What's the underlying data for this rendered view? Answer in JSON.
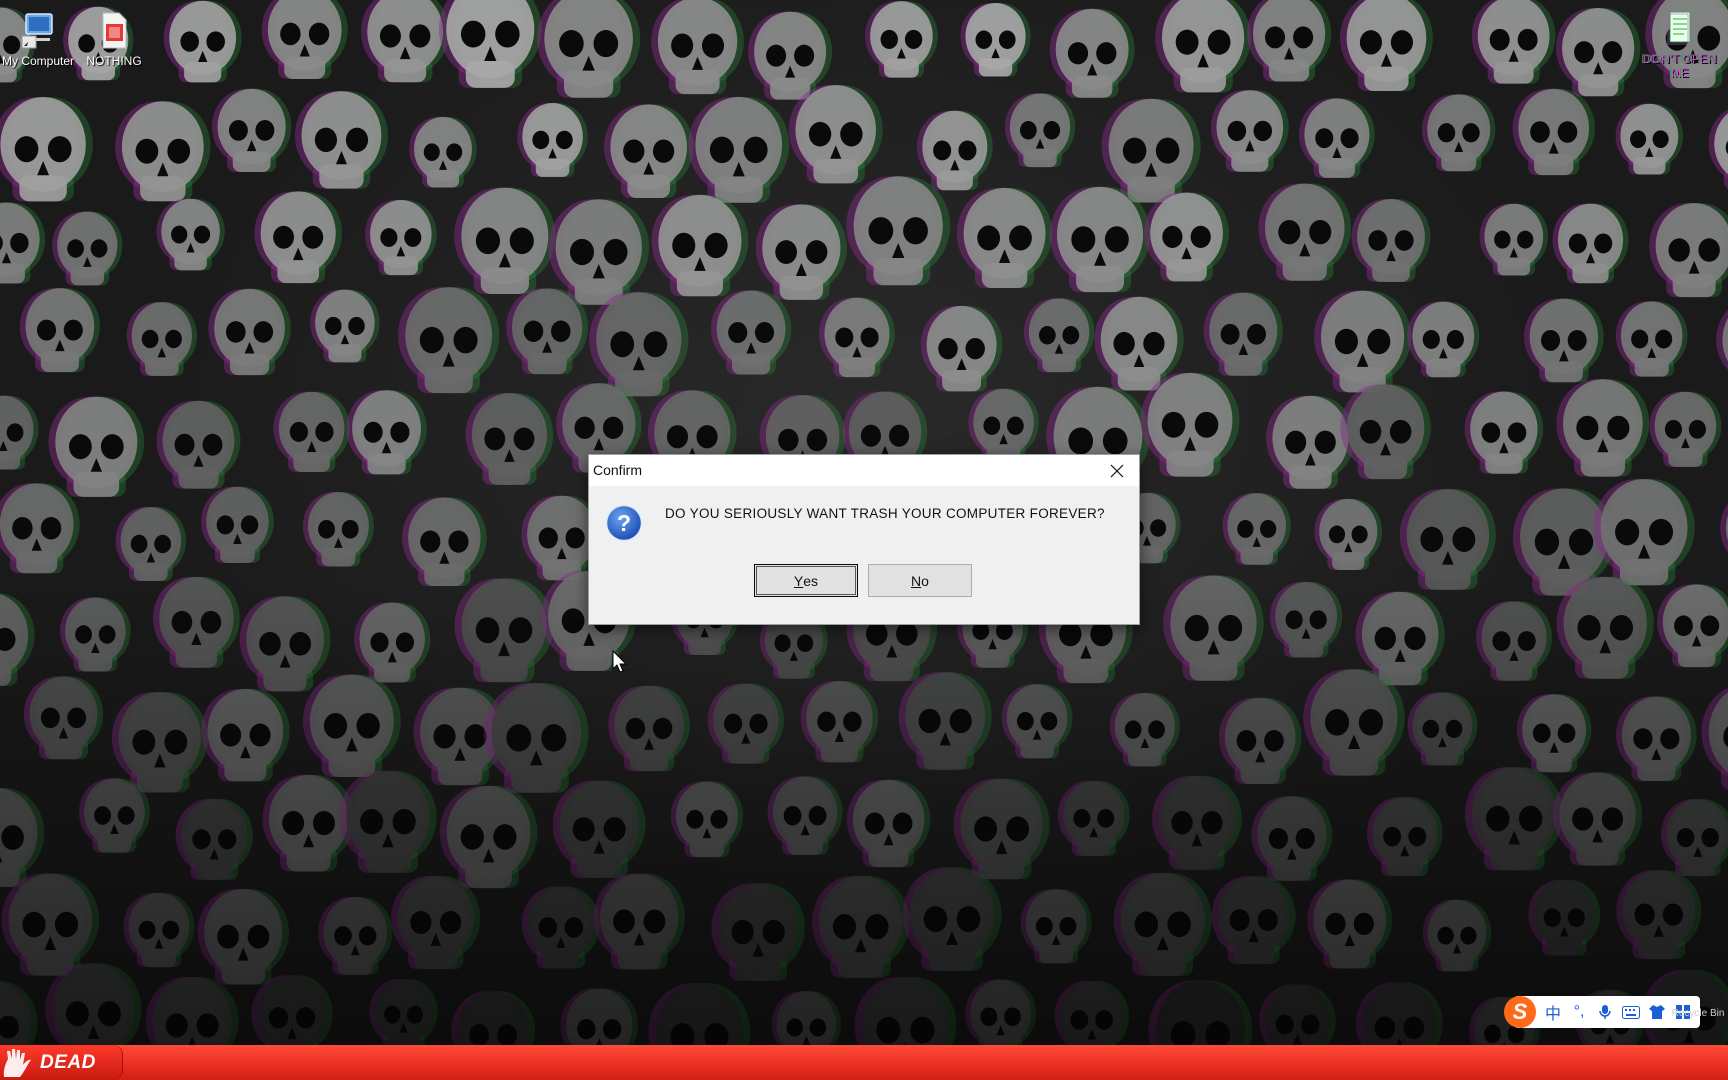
{
  "desktop": {
    "icons": [
      {
        "label": "My Computer",
        "icon": "computer-icon"
      },
      {
        "label": "NOTHING",
        "icon": "document-icon"
      },
      {
        "label": "DON'T OPEN ME",
        "icon": "notepad-icon"
      }
    ],
    "wallpaper": "skulls-glitch-wallpaper",
    "recycle_bin_label": "Recycle Bin"
  },
  "dialog": {
    "title": "Confirm",
    "message": "DO YOU SERIOUSLY WANT TRASH YOUR COMPUTER FOREVER?",
    "icon": "question-icon",
    "yes_label_mnemonic": "Y",
    "yes_label_rest": "es",
    "no_label_mnemonic": "N",
    "no_label_rest": "o",
    "close_icon": "close-icon"
  },
  "taskbar": {
    "start_label": "DEAD",
    "start_icon": "hand-icon",
    "color": "#e92e1f"
  },
  "ime_toolbar": {
    "logo": "S",
    "mode_label": "中",
    "punct_label": "°,",
    "icons": [
      "microphone-icon",
      "keyboard-icon",
      "skin-icon",
      "grid-icon"
    ]
  }
}
